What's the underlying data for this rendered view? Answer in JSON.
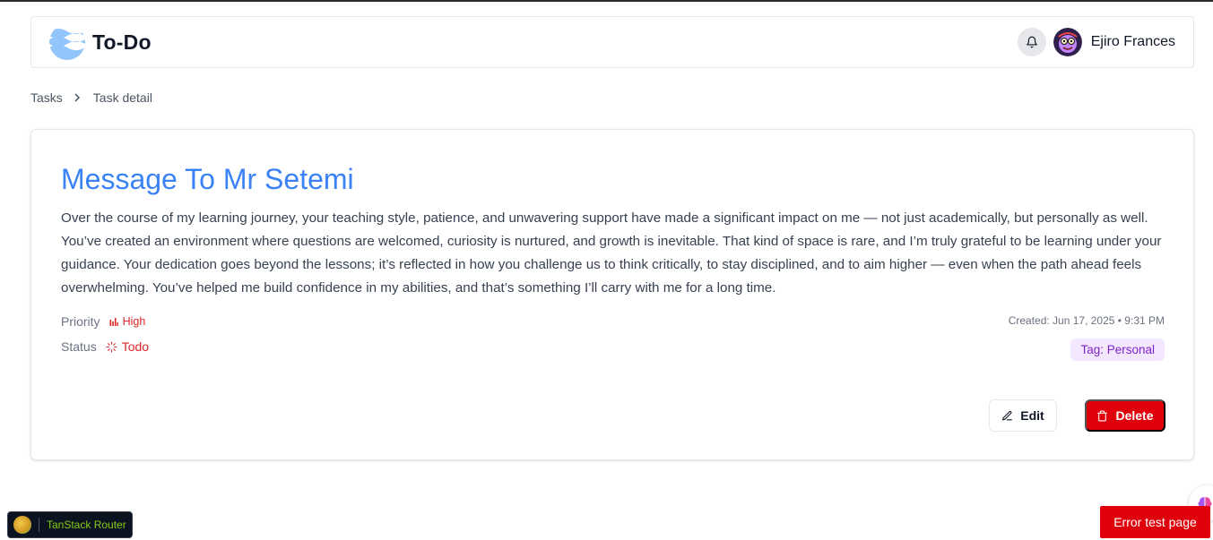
{
  "app": {
    "name": "To-Do"
  },
  "user": {
    "name": "Ejiro Frances"
  },
  "breadcrumb": {
    "items": [
      "Tasks",
      "Task detail"
    ]
  },
  "task": {
    "title": "Message To Mr Setemi",
    "body": "Over the course of my learning journey, your teaching style, patience, and unwavering support have made a significant impact on me — not just academically, but personally as well. You’ve created an environment where questions are welcomed, curiosity is nurtured, and growth is inevitable. That kind of space is rare, and I’m truly grateful to be learning under your guidance. Your dedication goes beyond the lessons; it’s reflected in how you challenge us to think critically, to stay disciplined, and to aim higher — even when the path ahead feels overwhelming. You’ve helped me build confidence in my abilities, and that’s something I’ll carry with me for a long time.",
    "priority_label": "Priority",
    "priority_value": "High",
    "status_label": "Status",
    "status_value": "Todo",
    "created": "Created: Jun 17, 2025 • 9:31 PM",
    "tag": "Tag: Personal"
  },
  "actions": {
    "edit_label": "Edit",
    "delete_label": "Delete"
  },
  "devtools": {
    "label": "TanStack Router"
  },
  "error_button": {
    "label": "Error test page"
  },
  "icons": {
    "logo": "wave-logo-icon",
    "bell": "bell-icon",
    "chevron": "chevron-right-icon",
    "priority": "bar-chart-icon",
    "status": "loader-icon",
    "edit": "pencil-icon",
    "delete": "trash-icon",
    "brain": "brain-icon"
  },
  "colors": {
    "title": "#3b82f6",
    "danger": "#e0000b",
    "status": "#dc2626",
    "tag_bg": "#f3e8ff",
    "tag_fg": "#7e22ce"
  }
}
